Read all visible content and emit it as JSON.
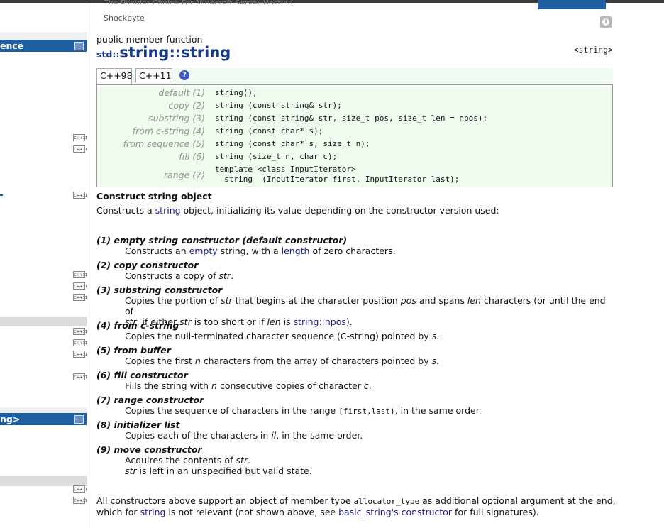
{
  "ad": {
    "tagline": "The Popular Choice For Minecraft Server Hosting.",
    "source": "Shockbyte",
    "info_icon": "info-icon"
  },
  "sidebar": {
    "header_reference": "ence",
    "header_string": "ng>",
    "cxx_badge": "C++11",
    "toggle_icon": "toggle-panel-icon"
  },
  "page": {
    "kind": "public member function",
    "namespace": "std::",
    "name": "string::string",
    "header": "<string>"
  },
  "tabs": [
    {
      "label": "C++98",
      "active": true
    },
    {
      "label": "C++11",
      "active": false
    }
  ],
  "help_label": "?",
  "declarations": [
    {
      "label": "default (1)",
      "code": "string();"
    },
    {
      "label": "copy (2)",
      "code": "string (const string& str);"
    },
    {
      "label": "substring (3)",
      "code": "string (const string& str, size_t pos, size_t len = npos);"
    },
    {
      "label": "from c-string (4)",
      "code": "string (const char* s);"
    },
    {
      "label": "from sequence (5)",
      "code": "string (const char* s, size_t n);"
    },
    {
      "label": "fill (6)",
      "code": "string (size_t n, char c);"
    },
    {
      "label": "range (7)",
      "code": "template <class InputIterator>\n  string  (InputIterator first, InputIterator last);"
    }
  ],
  "summary": {
    "heading": "Construct string object",
    "intro_prefix": "Constructs a ",
    "intro_link": "string",
    "intro_suffix": " object, initializing its value depending on the constructor version used:"
  },
  "items": [
    {
      "title": "(1) empty string constructor (default constructor)",
      "d1": "Constructs an ",
      "l1": "empty",
      "d2": " string, with a ",
      "l2": "length",
      "d3": " of zero characters."
    },
    {
      "title": "(2) copy constructor",
      "d1": "Constructs a copy of ",
      "v1": "str",
      "d2": "."
    },
    {
      "title": "(3) substring constructor",
      "line1_a": "Copies the portion of ",
      "line1_v1": "str",
      "line1_b": " that begins at the character position ",
      "line1_v2": "pos",
      "line1_c": " and spans ",
      "line1_v3": "len",
      "line1_d": " characters (or until the end of",
      "line2_v1": "str",
      "line2_a": ", if either ",
      "line2_v2": "str",
      "line2_b": " is too short or if ",
      "line2_v3": "len",
      "line2_c": " is ",
      "line2_link": "string::npos",
      "line2_d": ")."
    },
    {
      "title": "(4) from c-string",
      "d1": "Copies the null-terminated character sequence (C-string) pointed by ",
      "v1": "s",
      "d2": "."
    },
    {
      "title": "(5) from buffer",
      "d1": "Copies the first ",
      "v1": "n",
      "d2": " characters from the array of characters pointed by ",
      "v2": "s",
      "d3": "."
    },
    {
      "title": "(6) fill constructor",
      "d1": "Fills the string with ",
      "v1": "n",
      "d2": " consecutive copies of character ",
      "v2": "c",
      "d3": "."
    },
    {
      "title": "(7) range constructor",
      "d1": "Copies the sequence of characters in the range ",
      "code": "[first,last)",
      "d2": ", in the same order."
    },
    {
      "title": "(8) initializer list",
      "d1": "Copies each of the characters in ",
      "v1": "il",
      "d2": ", in the same order."
    },
    {
      "title": "(9) move constructor",
      "d1": "Acquires the contents of ",
      "v1": "str",
      "d2": ".",
      "line2_v": "str",
      "line2": " is left in an unspecified but valid state."
    }
  ],
  "footer": {
    "line1_a": "All constructors above support an object of member type ",
    "line1_code": "allocator_type",
    "line1_b": " as additional optional argument at the end,",
    "line2_a": "which for ",
    "line2_link1": "string",
    "line2_b": " is not relevant (not shown above, see ",
    "line2_link2": "basic_string's constructor",
    "line2_c": " for full signatures)."
  }
}
